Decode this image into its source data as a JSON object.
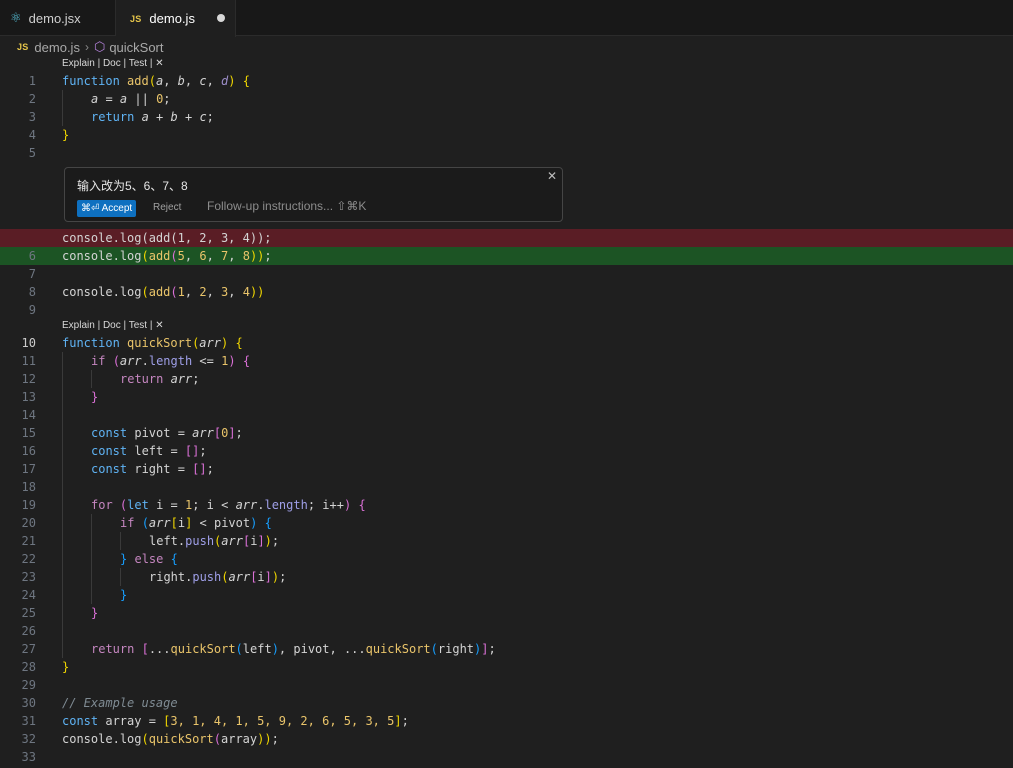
{
  "tabs": [
    {
      "label": "demo.jsx",
      "icon": "react-icon"
    },
    {
      "label": "demo.js",
      "icon": "js-icon",
      "modified": true
    }
  ],
  "breadcrumb": {
    "file": "demo.js",
    "symbol": "quickSort"
  },
  "codelens": {
    "label": "Explain | Doc | Test | ✕"
  },
  "prompt": {
    "text": "输入改为5、6、7、8",
    "accept": "⌘⏎ Accept",
    "reject": "Reject",
    "followup": "Follow-up instructions... ⇧⌘K",
    "close": "✕"
  },
  "line_numbers": [
    "1",
    "2",
    "3",
    "4",
    "5",
    "6",
    "7",
    "8",
    "9",
    "10",
    "11",
    "12",
    "13",
    "14",
    "15",
    "16",
    "17",
    "18",
    "19",
    "20",
    "21",
    "22",
    "23",
    "24",
    "25",
    "26",
    "27",
    "28",
    "29",
    "30",
    "31",
    "32",
    "33"
  ],
  "code": {
    "l1": [
      "function",
      " ",
      "add",
      "(",
      "a",
      ", ",
      "b",
      ", ",
      "c",
      ", ",
      "d",
      ")",
      " ",
      "{"
    ],
    "l2": [
      "a",
      " = ",
      "a",
      " || ",
      "0",
      ";"
    ],
    "l3": [
      "return",
      " ",
      "a",
      " + ",
      "b",
      " + ",
      "c",
      ";"
    ],
    "l4": [
      "}"
    ],
    "del": [
      "console.log(add(1, 2, 3, 4));"
    ],
    "ins": [
      "console",
      ".",
      "log",
      "(",
      "add",
      "(",
      "5",
      ", ",
      "6",
      ", ",
      "7",
      ", ",
      "8",
      "))",
      ";"
    ],
    "l8": [
      "console",
      ".",
      "log",
      "(",
      "add",
      "(",
      "1",
      ", ",
      "2",
      ", ",
      "3",
      ", ",
      "4",
      "))"
    ],
    "l10": [
      "function",
      " ",
      "quickSort",
      "(",
      "arr",
      ")",
      " ",
      "{"
    ],
    "l11": [
      "if",
      " ",
      "(",
      "arr",
      ".",
      "length",
      " <= ",
      "1",
      ")",
      " ",
      "{"
    ],
    "l12": [
      "return",
      " ",
      "arr",
      ";"
    ],
    "l13": [
      "}"
    ],
    "l15": [
      "const",
      " pivot = ",
      "arr",
      "[",
      "0",
      "]",
      ";"
    ],
    "l16": [
      "const",
      " left = ",
      "[]",
      ";"
    ],
    "l17": [
      "const",
      " right = ",
      "[]",
      ";"
    ],
    "l19": [
      "for",
      " ",
      "(",
      "let",
      " i = ",
      "1",
      "; i < ",
      "arr",
      ".",
      "length",
      "; i++",
      ")",
      " ",
      "{"
    ],
    "l20": [
      "if",
      " ",
      "(",
      "arr",
      "[",
      "i",
      "]",
      " < pivot",
      ")",
      " ",
      "{"
    ],
    "l21": [
      "left",
      ".",
      "push",
      "(",
      "arr",
      "[",
      "i",
      "]",
      ")",
      ";"
    ],
    "l22": [
      "}",
      " ",
      "else",
      " ",
      "{"
    ],
    "l23": [
      "right",
      ".",
      "push",
      "(",
      "arr",
      "[",
      "i",
      "]",
      ")",
      ";"
    ],
    "l24": [
      "}"
    ],
    "l25": [
      "}"
    ],
    "l27": [
      "return",
      " ",
      "[",
      "...",
      "quickSort",
      "(",
      "left",
      ")",
      ", pivot, ...",
      "quickSort",
      "(",
      "right",
      ")",
      "]",
      ";"
    ],
    "l28": [
      "}"
    ],
    "l30": [
      "// Example usage"
    ],
    "l31": [
      "const",
      " array = ",
      "[",
      "3, 1, 4, 1, 5, 9, 2, 6, 5, 3, 5",
      "]",
      ";"
    ],
    "l32": [
      "console",
      ".",
      "log",
      "(",
      "quickSort",
      "(",
      "array",
      "))",
      ";"
    ]
  },
  "colors": {
    "editor_bg": "#1f1f1f",
    "deleted_line": "#5a1d25",
    "inserted_line": "#1c5424",
    "accent": "#0e70c0"
  }
}
